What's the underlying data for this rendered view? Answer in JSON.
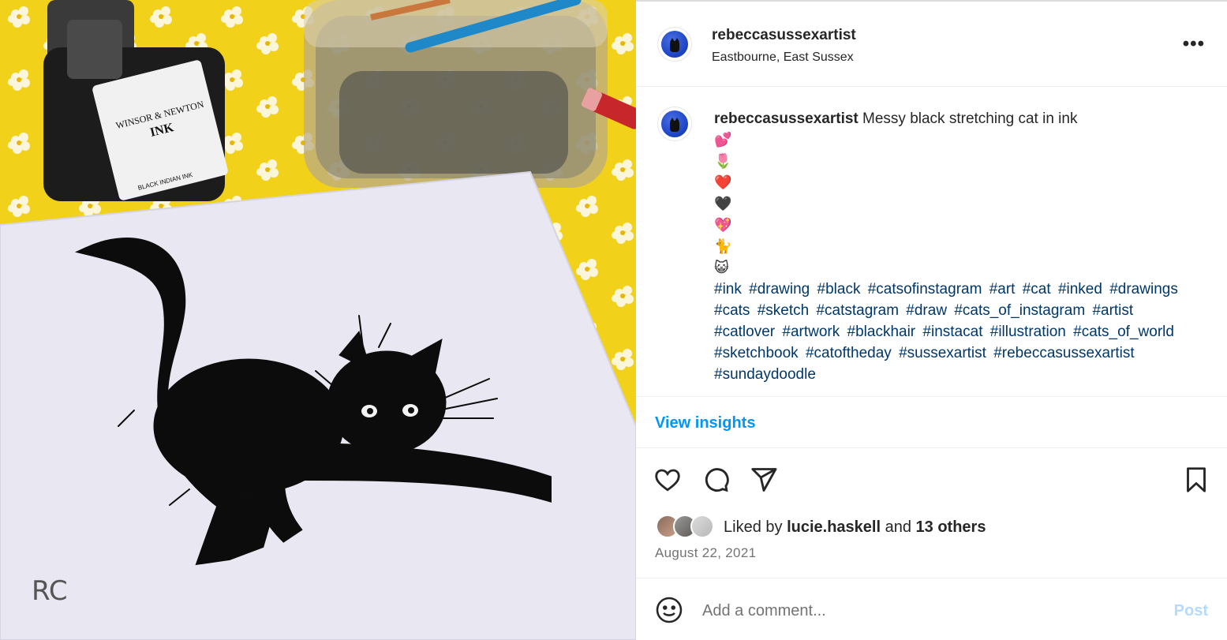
{
  "post": {
    "username": "rebeccasussexartist",
    "location": "Eastbourne, East Sussex",
    "more_icon": "more-horizontal-icon"
  },
  "caption": {
    "username": "rebeccasussexartist",
    "text": "Messy black stretching cat in ink",
    "emojis": [
      "💕",
      "🌷",
      "❤️",
      "🖤",
      "💖",
      "🐈",
      "😺"
    ],
    "hashtags": [
      "#ink",
      "#drawing",
      "#black",
      "#catsofinstagram",
      "#art",
      "#cat",
      "#inked",
      "#drawings",
      "#cats",
      "#sketch",
      "#catstagram",
      "#draw",
      "#cats_of_instagram",
      "#artist",
      "#catlover",
      "#artwork",
      "#blackhair",
      "#instacat",
      "#illustration",
      "#cats_of_world",
      "#sketchbook",
      "#catoftheday",
      "#sussexartist",
      "#rebeccasussexartist",
      "#sundaydoodle"
    ]
  },
  "insights": {
    "label": "View insights"
  },
  "actions": {
    "like_icon": "heart-icon",
    "comment_icon": "comment-bubble-icon",
    "share_icon": "paper-plane-icon",
    "save_icon": "bookmark-icon"
  },
  "likes": {
    "prefix": "Liked by",
    "user": "lucie.haskell",
    "joiner": "and",
    "others": "13 others"
  },
  "date": "August 22, 2021",
  "comment": {
    "placeholder": "Add a comment...",
    "post_label": "Post",
    "emoji_icon": "smiley-icon"
  },
  "photo": {
    "ink_label_brand": "WINSOR & NEWTON",
    "ink_label_type": "INK",
    "ink_label_name": "BLACK INDIAN INK",
    "signature": "RC"
  },
  "colors": {
    "link_blue": "#0095f6",
    "hashtag_blue": "#00376b",
    "post_disabled": "#b3dbff",
    "secondary_text": "#737373"
  }
}
